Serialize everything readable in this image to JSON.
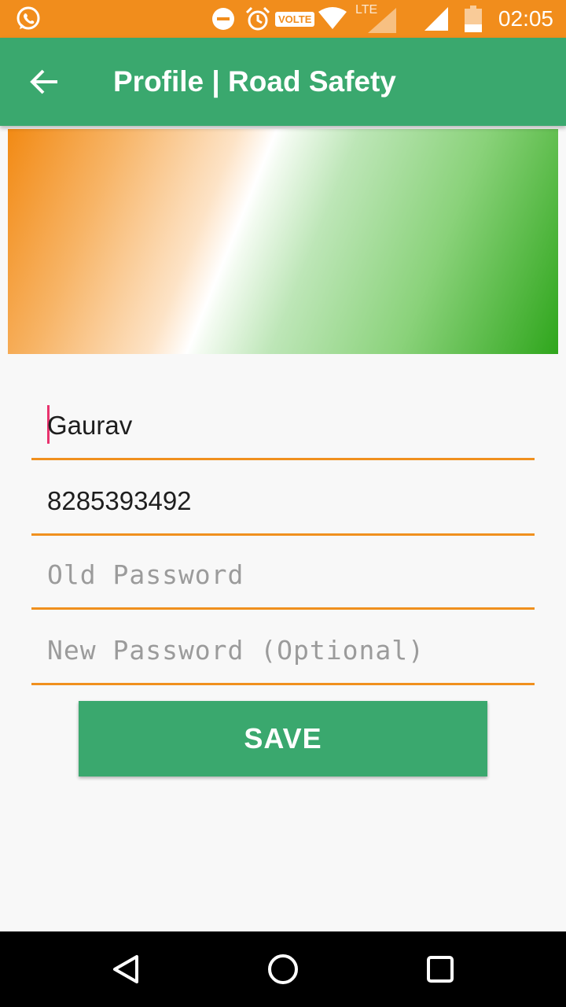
{
  "status_bar": {
    "time": "02:05",
    "volte_label": "VOLTE",
    "lte_label": "LTE",
    "icons": [
      "whatsapp-icon",
      "do-not-disturb-icon",
      "alarm-icon",
      "volte-icon",
      "wifi-icon",
      "lte-signal-icon",
      "signal-icon",
      "battery-icon"
    ]
  },
  "app_bar": {
    "title": "Profile | Road Safety",
    "back_icon": "arrow-back-icon"
  },
  "form": {
    "name_value": "Gaurav",
    "phone_value": "8285393492",
    "old_password_placeholder": "Old Password",
    "new_password_placeholder": "New Password (Optional)",
    "save_label": "SAVE"
  },
  "nav_bar": {
    "icons": [
      "back-triangle-icon",
      "home-circle-icon",
      "recents-square-icon"
    ]
  },
  "colors": {
    "status_bar": "#f18d1c",
    "app_bar": "#3aa86e",
    "field_underline": "#f0901e",
    "cursor": "#e8336e",
    "save_button": "#3aa86e"
  }
}
